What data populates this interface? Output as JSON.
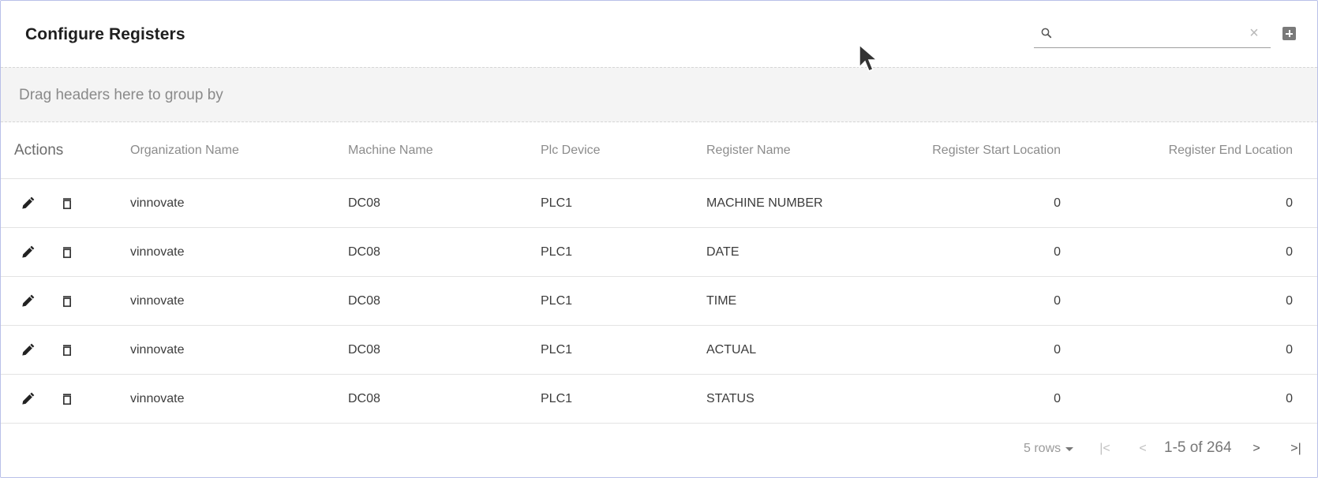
{
  "toolbar": {
    "title": "Configure Registers",
    "search": {
      "value": "",
      "placeholder": ""
    }
  },
  "group_panel": {
    "text": "Drag headers here to group by"
  },
  "table": {
    "headers": {
      "actions": "Actions",
      "organization_name": "Organization Name",
      "machine_name": "Machine Name",
      "plc_device": "Plc Device",
      "register_name": "Register Name",
      "register_start_location": "Register Start Location",
      "register_end_location": "Register End Location"
    },
    "rows": [
      {
        "organization_name": "vinnovate",
        "machine_name": "DC08",
        "plc_device": "PLC1",
        "register_name": "MACHINE NUMBER",
        "register_start_location": "0",
        "register_end_location": "0"
      },
      {
        "organization_name": "vinnovate",
        "machine_name": "DC08",
        "plc_device": "PLC1",
        "register_name": "DATE",
        "register_start_location": "0",
        "register_end_location": "0"
      },
      {
        "organization_name": "vinnovate",
        "machine_name": "DC08",
        "plc_device": "PLC1",
        "register_name": "TIME",
        "register_start_location": "0",
        "register_end_location": "0"
      },
      {
        "organization_name": "vinnovate",
        "machine_name": "DC08",
        "plc_device": "PLC1",
        "register_name": "ACTUAL",
        "register_start_location": "0",
        "register_end_location": "0"
      },
      {
        "organization_name": "vinnovate",
        "machine_name": "DC08",
        "plc_device": "PLC1",
        "register_name": "STATUS",
        "register_start_location": "0",
        "register_end_location": "0"
      }
    ]
  },
  "pagination": {
    "rows_per_page": "5 rows",
    "page_info": "1-5 of 264"
  },
  "icons": {
    "search": "search-icon",
    "clear": "close-icon",
    "add": "add-box-icon",
    "edit": "pencil-icon",
    "delete": "trash-icon",
    "first": "first-page-icon",
    "prev": "chevron-left-icon",
    "next": "chevron-right-icon",
    "last": "last-page-icon"
  }
}
